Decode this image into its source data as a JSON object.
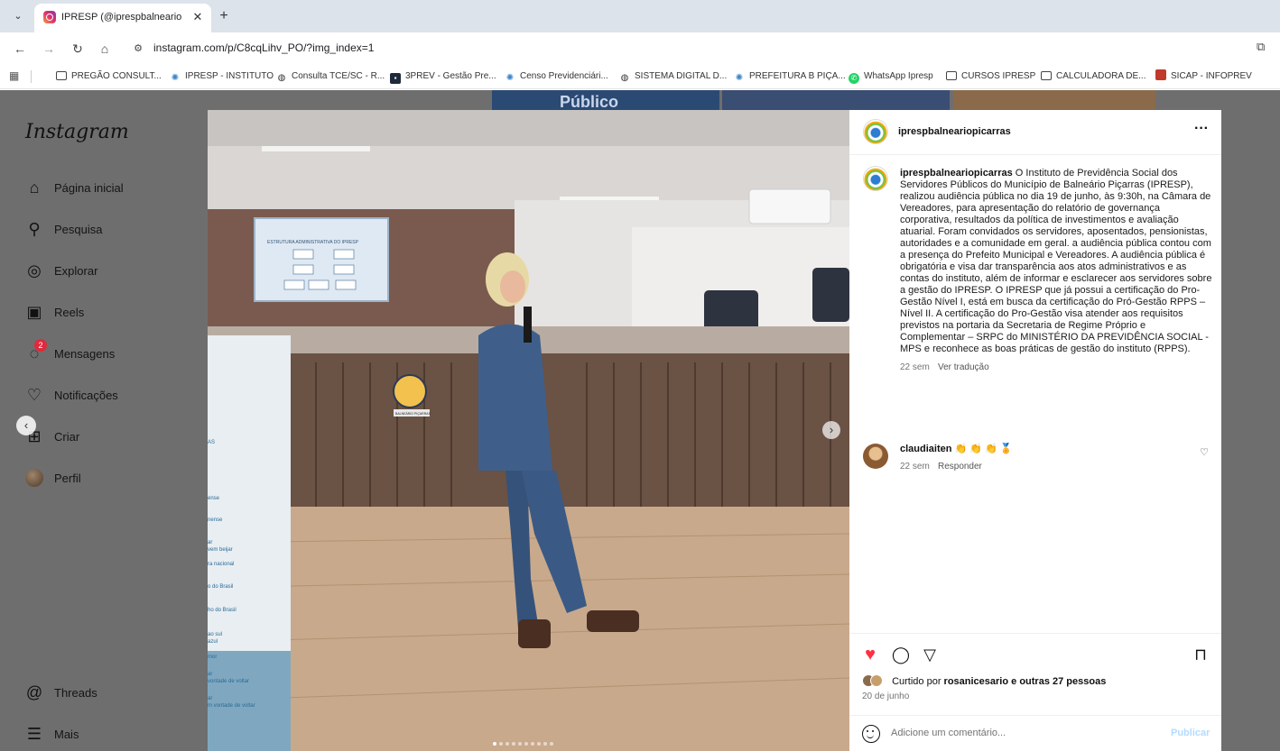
{
  "browser": {
    "tab_title": "IPRESP (@iprespbalneariopicarras)",
    "tab_close": "✕",
    "new_tab": "+",
    "tab_list": "⌄",
    "url": "instagram.com/p/C8cqLihv_PO/?img_index=1",
    "nav": {
      "back": "←",
      "forward": "→",
      "reload": "↻",
      "home": "⌂"
    },
    "bookmarks": [
      {
        "label": "PREGÃO CONSULT...",
        "icon": "folder-icon"
      },
      {
        "label": "IPRESP - INSTITUTO",
        "icon": "ipresp-icon"
      },
      {
        "label": "Consulta TCE/SC - R...",
        "icon": "globe-icon"
      },
      {
        "label": "3PREV - Gestão Pre...",
        "icon": "3prev-icon"
      },
      {
        "label": "Censo Previdenciári...",
        "icon": "ipresp-icon"
      },
      {
        "label": "SISTEMA DIGITAL D...",
        "icon": "globe-icon"
      },
      {
        "label": "PREFEITURA B PIÇA...",
        "icon": "ipresp-icon"
      },
      {
        "label": "WhatsApp Ipresp",
        "icon": "whatsapp-icon"
      },
      {
        "label": "CURSOS IPRESP",
        "icon": "folder-icon"
      },
      {
        "label": "CALCULADORA DE...",
        "icon": "folder-icon"
      },
      {
        "label": "SICAP - INFOPREV",
        "icon": "sicap-icon"
      }
    ]
  },
  "instagram": {
    "logo": "Instagram",
    "nav": [
      {
        "label": "Página inicial",
        "icon": "home-icon",
        "glyph": "⌂"
      },
      {
        "label": "Pesquisa",
        "icon": "search-icon",
        "glyph": "⚲"
      },
      {
        "label": "Explorar",
        "icon": "compass-icon",
        "glyph": "◎"
      },
      {
        "label": "Reels",
        "icon": "reels-icon",
        "glyph": "▣"
      },
      {
        "label": "Mensagens",
        "icon": "messenger-icon",
        "glyph": "◌",
        "badge": "2"
      },
      {
        "label": "Notificações",
        "icon": "heart-icon",
        "glyph": "♡"
      },
      {
        "label": "Criar",
        "icon": "create-icon",
        "glyph": "⊞"
      },
      {
        "label": "Perfil",
        "icon": "profile-avatar-icon",
        "glyph": ""
      }
    ],
    "nav_bottom": [
      {
        "label": "Threads",
        "icon": "threads-icon",
        "glyph": "@"
      },
      {
        "label": "Mais",
        "icon": "menu-icon",
        "glyph": "☰"
      }
    ]
  },
  "post": {
    "username": "iprespbalneariopicarras",
    "more": "···",
    "caption_user": "iprespbalneariopicarras",
    "caption_text": "O Instituto de Previdência Social dos Servidores Públicos do Município de Balneário Piçarras (IPRESP), realizou audiência pública no dia 19 de junho, às 9:30h, na Câmara de Vereadores, para apresentação do relatório de governança corporativa, resultados da política de investimentos e avaliação atuarial. Foram convidados os servidores, aposentados, pensionistas, autoridades e a comunidade em geral. a audiência pública contou com a presença do Prefeito Municipal e Vereadores. A audiência pública é obrigatória e visa dar transparência aos atos administrativos e as contas do instituto, além de informar e esclarecer aos servidores sobre a gestão do IPRESP. O IPRESP que já possui a certificação do Pro-Gestão Nível I, está em busca da certificação do Pró-Gestão RPPS – Nível II. A certificação do Pro-Gestão visa atender aos requisitos previstos na portaria da Secretaria de Regime Próprio e Complementar – SRPC do MINISTÉRIO DA PREVIDÊNCIA SOCIAL - MPS e reconhece as boas práticas de gestão do instituto (RPPS).",
    "caption_age": "22 sem",
    "translate": "Ver tradução",
    "comment": {
      "user": "claudiaiten",
      "text": "👏 👏 👏 🏅",
      "age": "22 sem",
      "reply": "Responder"
    },
    "likes_prefix": "Curtido por",
    "likes_user": "rosanicesario",
    "likes_suffix": "e outras 27 pessoas",
    "date": "20 de junho",
    "comment_placeholder": "Adicione um comentário...",
    "publish": "Publicar",
    "liked": true,
    "accent_red": "#ff3040",
    "carousel": {
      "total": 10,
      "current": 1
    }
  },
  "photo": {
    "projector_title": "ESTRUTURA ADMINISTRATIVA DO IPRESP",
    "podium_label": "BALNEÁRIO PIÇARRAS",
    "banner_lines": [
      "AS",
      "ense",
      "nense",
      "ar",
      "vem beijar",
      "ra nacional",
      "o do Brasil",
      "ho do Brasil",
      "ao sul",
      "azul",
      "mor",
      "ar",
      "vontade de voltar",
      "ar",
      "m vontade de voltar"
    ],
    "top_sign": "Público"
  }
}
